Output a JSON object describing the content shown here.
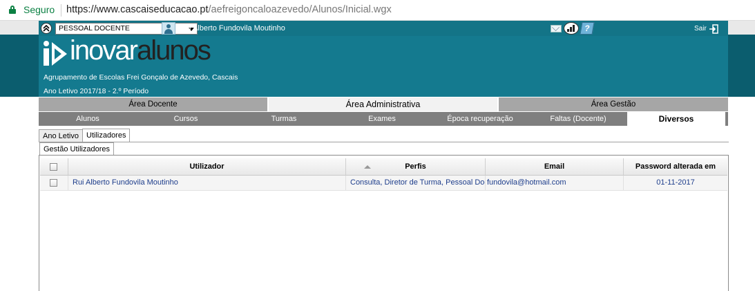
{
  "browser": {
    "secure_label": "Seguro",
    "url_host": "https://www.cascaiseducacao.pt",
    "url_path": "/aefreigoncaloazevedo/Alunos/Inicial.wgx"
  },
  "topbar": {
    "profile_selected": "PESSOAL DOCENTE",
    "user_name": "Rui Alberto Fundovila Moutinho",
    "exit_label": "Sair"
  },
  "header": {
    "logo_part1": "inovar",
    "logo_part2": "alunos",
    "school": "Agrupamento de Escolas Frei Gonçalo de Azevedo, Cascais",
    "year": "Ano Letivo 2017/18 - 2.º Período"
  },
  "areas": [
    "Área Docente",
    "Área Administrativa",
    "Área Gestão"
  ],
  "subtabs": [
    "Alunos",
    "Cursos",
    "Turmas",
    "Exames",
    "Época recuperação",
    "Faltas (Docente)",
    "Diversos"
  ],
  "tabs_level3": [
    "Ano Letivo",
    "Utilizadores"
  ],
  "tabs_level4": [
    "Gestão Utilizadores"
  ],
  "grid": {
    "columns": [
      "Utilizador",
      "Perfis",
      "Email",
      "Password alterada em"
    ],
    "rows": [
      {
        "utilizador": "Rui Alberto Fundovila Moutinho",
        "perfis": "Consulta, Diretor de Turma, Pessoal Docente",
        "email": "fundovila@hotmail.com",
        "password_date": "01-11-2017"
      }
    ]
  },
  "colors": {
    "header_bg": "#147a8f",
    "header_strip": "#0b5d6e",
    "secure_green": "#0b8043",
    "link_blue": "#1d3d8b"
  },
  "icons": [
    "lock-icon",
    "collapse-icon",
    "dropdown-arrow-icon",
    "user-icon",
    "mail-icon",
    "stats-icon",
    "help-icon",
    "exit-icon",
    "sort-asc-icon"
  ]
}
